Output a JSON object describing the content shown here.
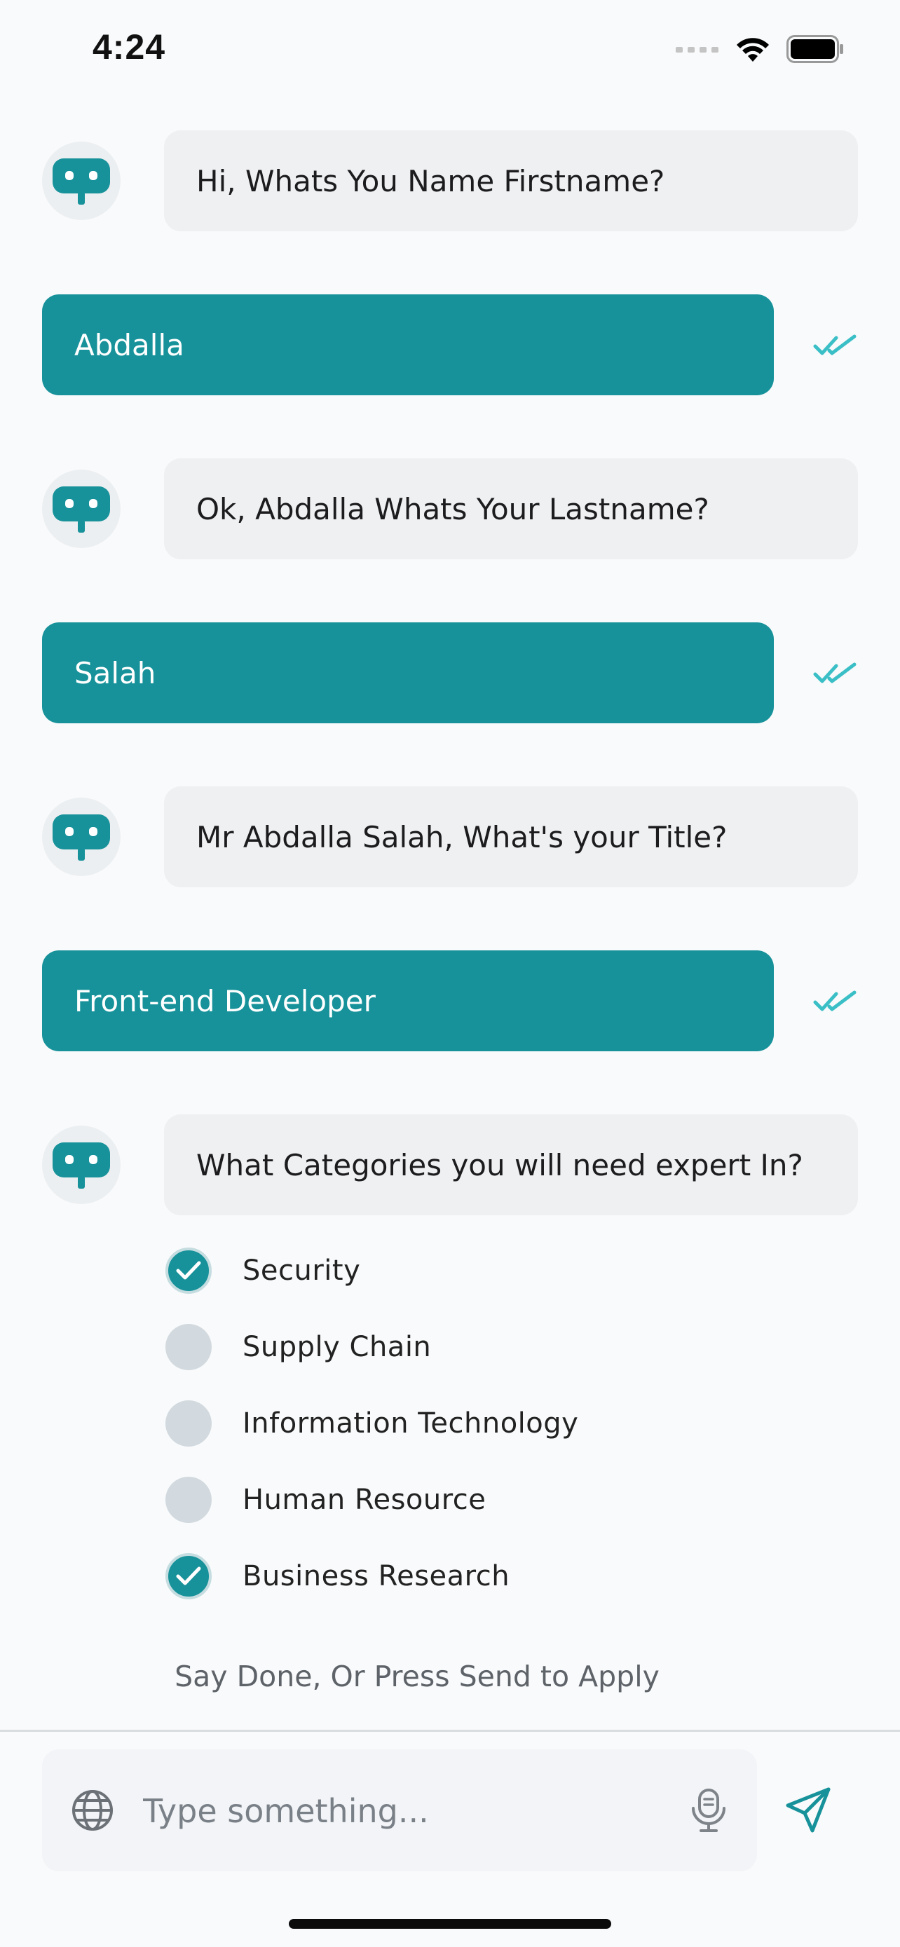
{
  "status_bar": {
    "time": "4:24"
  },
  "messages": [
    {
      "role": "bot",
      "text": "Hi, Whats You Name Firstname?"
    },
    {
      "role": "user",
      "text": "Abdalla"
    },
    {
      "role": "bot",
      "text": "Ok, Abdalla Whats Your Lastname?"
    },
    {
      "role": "user",
      "text": "Salah"
    },
    {
      "role": "bot",
      "text": "Mr Abdalla Salah, What's your Title?"
    },
    {
      "role": "user",
      "text": "Front-end Developer"
    },
    {
      "role": "bot",
      "text": "What Categories you will need expert In?"
    }
  ],
  "options": [
    {
      "label": "Security",
      "checked": true
    },
    {
      "label": "Supply Chain",
      "checked": false
    },
    {
      "label": "Information Technology",
      "checked": false
    },
    {
      "label": "Human Resource",
      "checked": false
    },
    {
      "label": "Business Research",
      "checked": true
    }
  ],
  "hint": "Say Done, Or Press Send to Apply",
  "composer": {
    "placeholder": "Type something..."
  },
  "colors": {
    "accent": "#17929a",
    "read_tick": "#3bbfc6"
  },
  "icons": {
    "avatar": "bot-avatar-icon",
    "read": "double-check-icon",
    "language": "globe-icon",
    "voice": "microphone-icon",
    "send": "send-icon"
  }
}
